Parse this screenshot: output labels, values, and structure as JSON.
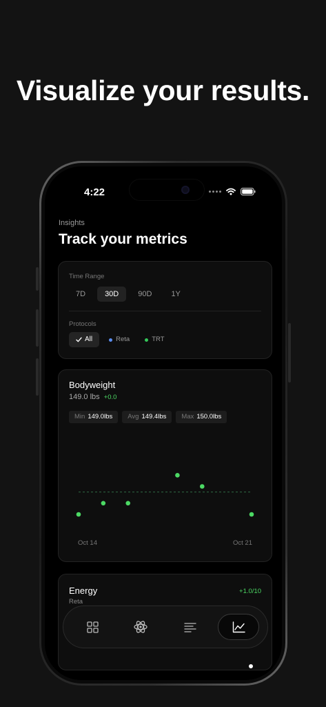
{
  "headline": "Visualize your results.",
  "status_bar": {
    "time": "4:22"
  },
  "header": {
    "section_label": "Insights",
    "title": "Track your metrics"
  },
  "filters": {
    "time_range_label": "Time Range",
    "ranges": [
      "7D",
      "30D",
      "90D",
      "1Y"
    ],
    "selected_range": "30D",
    "protocols_label": "Protocols",
    "protocol_all": "All",
    "protocols": [
      {
        "name": "Reta",
        "color": "#5b8def"
      },
      {
        "name": "TRT",
        "color": "#34c759"
      }
    ]
  },
  "bodyweight": {
    "title": "Bodyweight",
    "value": "149.0 lbs",
    "delta": "+0.0",
    "stats": [
      {
        "key": "Min",
        "value": "149.0lbs"
      },
      {
        "key": "Avg",
        "value": "149.4lbs"
      },
      {
        "key": "Max",
        "value": "150.0lbs"
      }
    ]
  },
  "chart_data": {
    "type": "scatter",
    "title": "Bodyweight",
    "xlabel": "",
    "ylabel": "",
    "x_tick_labels": [
      "Oct 14",
      "Oct 21"
    ],
    "x": [
      "Oct 14",
      "Oct 15",
      "Oct 16",
      "Oct 18",
      "Oct 19",
      "Oct 21"
    ],
    "series": [
      {
        "values": [
          149.0,
          149.2,
          149.2,
          149.7,
          149.5,
          149.0
        ],
        "color": "#4cd964"
      }
    ],
    "average_line": 149.4,
    "ylim": [
      149.0,
      150.0
    ],
    "grid": false
  },
  "energy": {
    "title": "Energy",
    "delta": "+1.0/10",
    "subtitle": "Reta"
  },
  "tabbar": {
    "tabs": [
      {
        "icon": "grid-icon"
      },
      {
        "icon": "atom-icon"
      },
      {
        "icon": "list-icon"
      },
      {
        "icon": "chart-line-icon",
        "active": true
      }
    ]
  }
}
